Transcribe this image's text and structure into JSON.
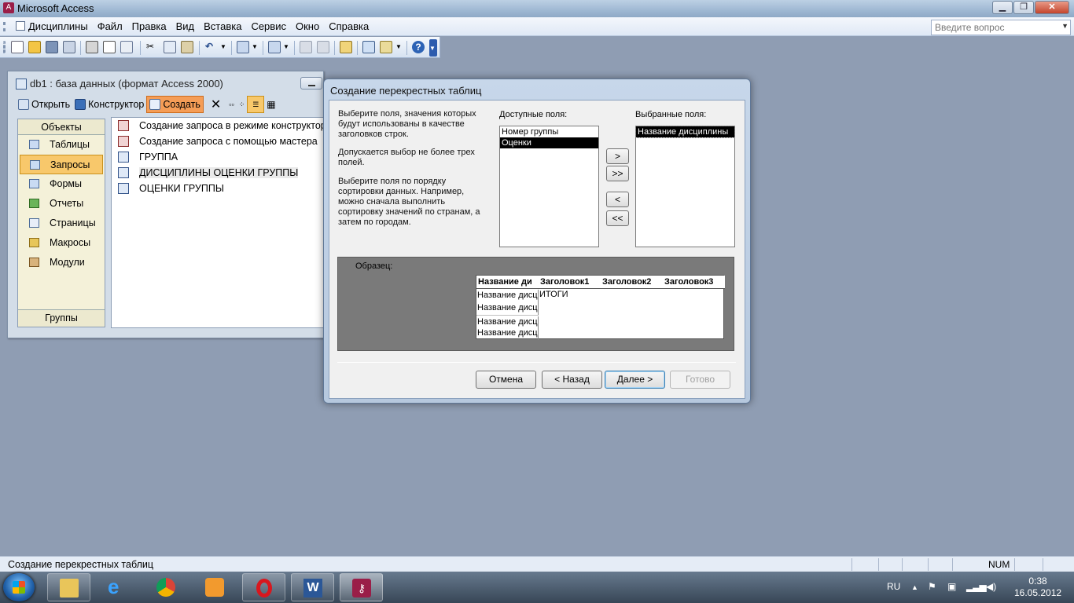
{
  "app": {
    "title": "Microsoft Access"
  },
  "menu": {
    "items": [
      "Дисциплины",
      "Файл",
      "Правка",
      "Вид",
      "Вставка",
      "Сервис",
      "Окно",
      "Справка"
    ],
    "ask_placeholder": "Введите вопрос"
  },
  "db_window": {
    "title": "db1 : база данных (формат Access 2000)",
    "tools": {
      "open": "Открыть",
      "design": "Конструктор",
      "create": "Создать"
    },
    "objects_header": "Объекты",
    "objects": [
      "Таблицы",
      "Запросы",
      "Формы",
      "Отчеты",
      "Страницы",
      "Макросы",
      "Модули"
    ],
    "groups_footer": "Группы",
    "list": [
      "Создание запроса в режиме конструктора",
      "Создание запроса с помощью мастера",
      "ГРУППА",
      "ДИСЦИПЛИНЫ ОЦЕНКИ ГРУППЫ",
      "ОЦЕНКИ ГРУППЫ"
    ]
  },
  "dialog": {
    "title": "Создание перекрестных таблиц",
    "instructions": {
      "p1": "Выберите поля, значения которых будут использованы в качестве заголовков строк.",
      "p2": "Допускается выбор не более трех полей.",
      "p3": "Выберите поля по порядку сортировки данных.  Например, можно сначала выполнить сортировку значений по странам, а затем по городам."
    },
    "available_label": "Доступные поля:",
    "available": [
      "Номер группы",
      "Оценки"
    ],
    "selected_label": "Выбранные поля:",
    "selected": [
      "Название дисциплины"
    ],
    "move_buttons": [
      ">",
      ">>",
      "<",
      "<<"
    ],
    "sample": {
      "label": "Образец:",
      "headers": [
        "Название ди",
        "Заголовок1",
        "Заголовок2",
        "Заголовок3"
      ],
      "rows": [
        "Название дисц",
        "Название дисц",
        "Название дисц",
        "Название дисц"
      ],
      "total": "ИТОГИ"
    },
    "buttons": {
      "cancel": "Отмена",
      "back": "< Назад",
      "next": "Далее >",
      "finish": "Готово"
    }
  },
  "status": {
    "text": "Создание перекрестных таблиц",
    "num": "NUM"
  },
  "taskbar": {
    "lang": "RU",
    "time": "0:38",
    "date": "16.05.2012"
  }
}
